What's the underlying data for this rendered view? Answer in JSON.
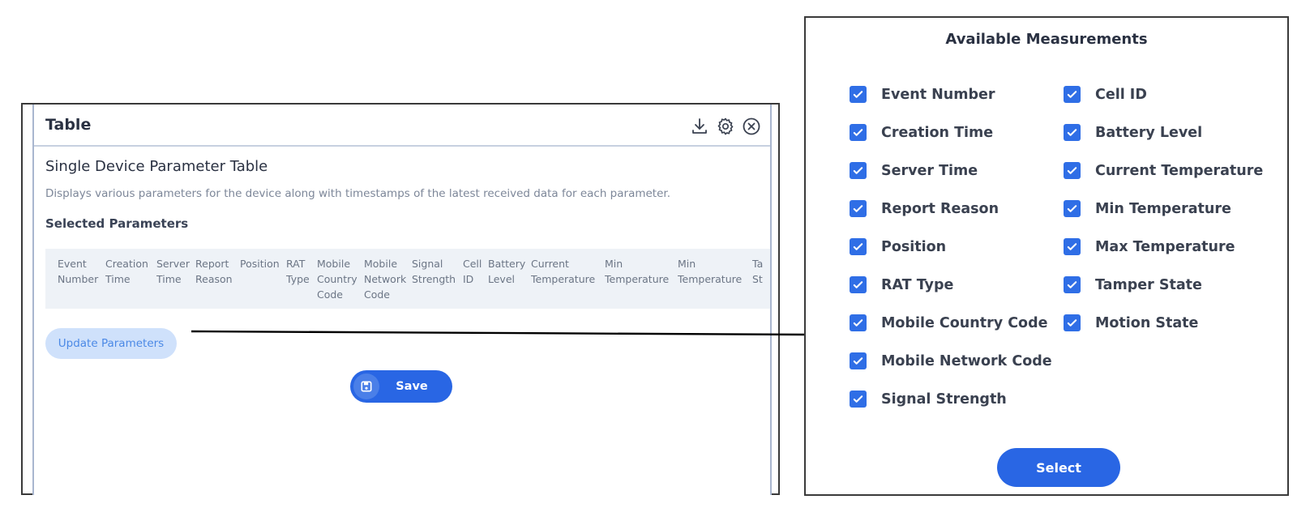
{
  "widget": {
    "title": "Table",
    "icons": [
      "download-icon",
      "gear-icon",
      "close-circle-icon"
    ],
    "table_name": "Single Device Parameter Table",
    "description": "Displays various parameters for the device along with timestamps of the latest received data for each parameter.",
    "selected_title": "Selected Parameters",
    "columns": [
      "Event Number",
      "Creation Time",
      "Server Time",
      "Report Reason",
      "Position",
      "RAT Type",
      "Mobile Country Code",
      "Mobile Network Code",
      "Signal Strength",
      "Cell ID",
      "Battery Level",
      "Current Temperature",
      "Min Temperature",
      "Min Temperature",
      "Ta St"
    ],
    "update_button": "Update Parameters",
    "save_button": "Save"
  },
  "measurements": {
    "title": "Available Measurements",
    "left": [
      {
        "label": "Event Number",
        "checked": true
      },
      {
        "label": "Creation Time",
        "checked": true
      },
      {
        "label": "Server Time",
        "checked": true
      },
      {
        "label": "Report Reason",
        "checked": true
      },
      {
        "label": "Position",
        "checked": true
      },
      {
        "label": "RAT Type",
        "checked": true
      },
      {
        "label": "Mobile Country Code",
        "checked": true
      },
      {
        "label": "Mobile Network Code",
        "checked": true
      },
      {
        "label": "Signal Strength",
        "checked": true
      }
    ],
    "right": [
      {
        "label": "Cell ID",
        "checked": true
      },
      {
        "label": "Battery Level",
        "checked": true
      },
      {
        "label": "Current Temperature",
        "checked": true
      },
      {
        "label": "Min Temperature",
        "checked": true
      },
      {
        "label": "Max Temperature",
        "checked": true
      },
      {
        "label": "Tamper State",
        "checked": true
      },
      {
        "label": "Motion State",
        "checked": true
      }
    ],
    "select_button": "Select"
  },
  "colors": {
    "accent": "#2966e4",
    "checkbox": "#2f6ee6",
    "update_bg": "#cfe1fb",
    "update_text": "#4b89e6",
    "strip_bg": "#eef2f7"
  }
}
